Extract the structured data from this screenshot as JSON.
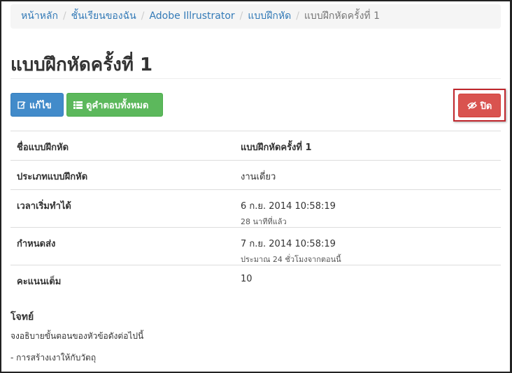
{
  "breadcrumb": {
    "items": [
      "หน้าหลัก",
      "ชั้นเรียนของฉัน",
      "Adobe Illrustrator",
      "แบบฝึกหัด"
    ],
    "current": "แบบฝึกหัดครั้งที่ 1",
    "separator": "/"
  },
  "page": {
    "title": "แบบฝึกหัดครั้งที่ 1"
  },
  "toolbar": {
    "edit_label": "แก้ไข",
    "answers_label": "ดูคำตอบทั้งหมด",
    "close_label": "ปิด"
  },
  "details": [
    {
      "label": "ชื่อแบบฝึกหัด",
      "value": "แบบฝึกหัดครั้งที่ 1",
      "sub": ""
    },
    {
      "label": "ประเภทแบบฝึกหัด",
      "value": "งานเดี่ยว",
      "sub": ""
    },
    {
      "label": "เวลาเริ่มทำได้",
      "value": "6 ก.ย. 2014 10:58:19",
      "sub": "28 นาทีที่แล้ว"
    },
    {
      "label": "กำหนดส่ง",
      "value": "7 ก.ย. 2014 10:58:19",
      "sub": "ประมาณ 24 ชั่วโมงจากตอนนี้"
    },
    {
      "label": "คะแนนเต็ม",
      "value": "10",
      "sub": ""
    }
  ],
  "problem": {
    "heading": "โจทย์",
    "lines": [
      "จงอธิบายขั้นตอนของหัวข้อดังต่อไปนี้",
      "- การสร้างเงาให้กับวัตถุ"
    ]
  },
  "icons": {
    "edit": "edit-icon",
    "list": "list-icon",
    "close": "eye-slash-icon"
  },
  "colors": {
    "link": "#337ab7",
    "edit_button": "#428bca",
    "answers_button": "#5cb85c",
    "close_button": "#d9534f",
    "highlight": "#c0272d"
  }
}
